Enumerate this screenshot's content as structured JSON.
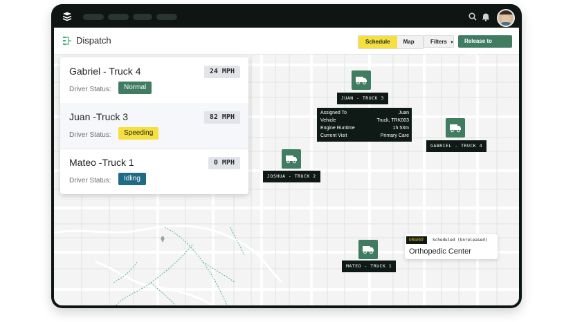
{
  "header": {
    "title": "Dispatch",
    "view_toggle": [
      "Schedule",
      "Map"
    ],
    "active_view": "Schedule",
    "filters_label": "Filters",
    "release_label": "Release to Tech"
  },
  "trucks": [
    {
      "name": "Gabriel - Truck 4",
      "speed": "24 MPH",
      "status_label": "Driver Status:",
      "status": "Normal",
      "status_color": "#3f7c62"
    },
    {
      "name": "Juan -Truck 3",
      "speed": "82 MPH",
      "status_label": "Driver Status:",
      "status": "Speeding",
      "status_color": "#f5e040"
    },
    {
      "name": "Mateo -Truck 1",
      "speed": "0 MPH",
      "status_label": "Driver Status:",
      "status": "Idling",
      "status_color": "#1d6b84"
    }
  ],
  "map_markers": [
    {
      "label": "JUAN - TRUCK 3"
    },
    {
      "label": "GABRIEL - TRUCK 4"
    },
    {
      "label": "JOSHUA - TRUCK 2"
    },
    {
      "label": "MATEO - TRUCK 1"
    }
  ],
  "info_popup": {
    "rows": [
      {
        "key": "Assigned To",
        "value": "Juan"
      },
      {
        "key": "Vehicle",
        "value": "Truck, TRK003"
      },
      {
        "key": "Engine Runtime",
        "value": "1h 53m"
      },
      {
        "key": "Current Visit",
        "value": "Primary Care"
      }
    ]
  },
  "urgent_card": {
    "tag": "URGENT",
    "status": "Scheduled (Unreleased)",
    "place": "Orthopedic Center"
  },
  "colors": {
    "accent_green": "#3f7c62",
    "accent_yellow": "#f5e040",
    "dark": "#0f1a16"
  },
  "icons": [
    "menu-logo-icon",
    "search-icon",
    "bell-icon",
    "dispatch-icon",
    "truck-icon",
    "map-pin-icon"
  ]
}
